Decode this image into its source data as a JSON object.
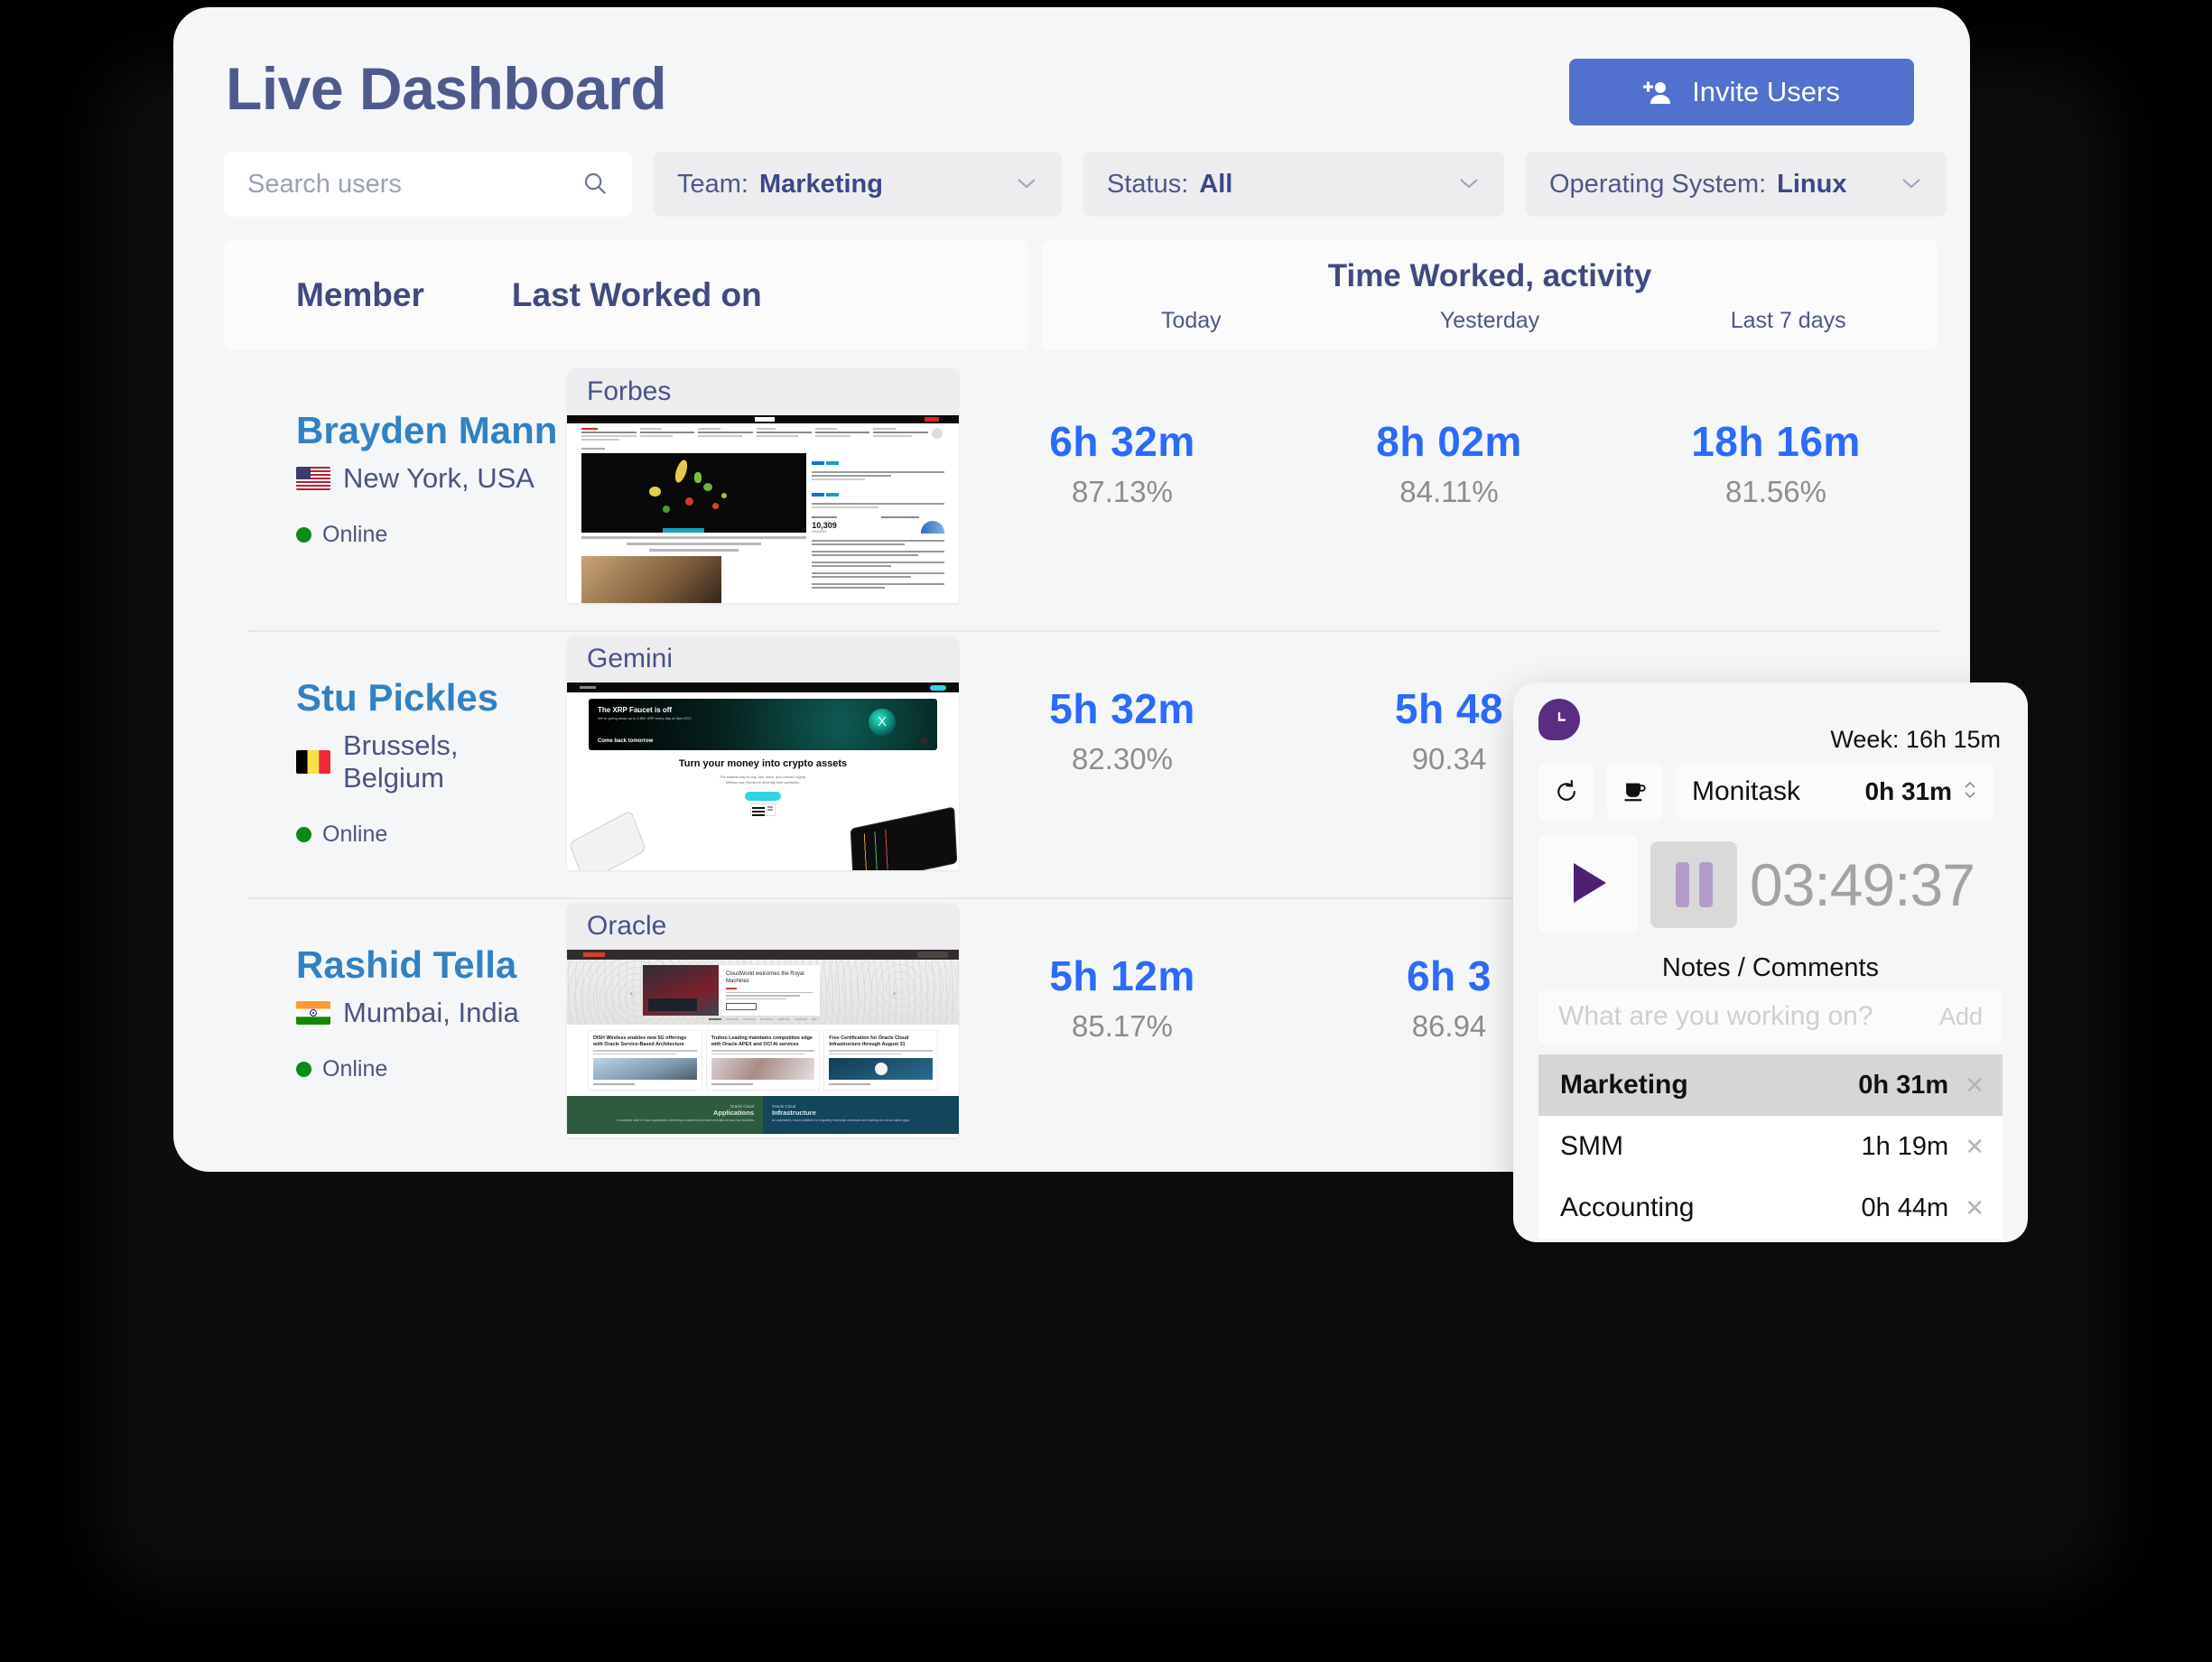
{
  "header": {
    "title": "Live Dashboard",
    "invite_label": "Invite Users",
    "invite_icon": "add-user-icon",
    "accent_color": "#5271ce",
    "title_color": "#4e5a8c"
  },
  "filters": {
    "search_placeholder": "Search users",
    "search_value": "",
    "search_icon": "search-icon",
    "team": {
      "label": "Team:",
      "value": "Marketing"
    },
    "status": {
      "label": "Status:",
      "value": "All"
    },
    "os": {
      "label": "Operating System:",
      "value": "Linux"
    },
    "chevron": "⌄"
  },
  "table": {
    "col_member": "Member",
    "col_last_worked": "Last Worked on",
    "group_title": "Time Worked, activity",
    "subcols": [
      "Today",
      "Yesterday",
      "Last 7 days"
    ]
  },
  "members": [
    {
      "name": "Brayden Mann",
      "location": "New York, USA",
      "flag": "flag-usa",
      "status": "Online",
      "status_color": "#0a8b19",
      "site": "Forbes",
      "today_time": "6h 32m",
      "today_pct": "87.13%",
      "yesterday_time": "8h 02m",
      "yesterday_pct": "84.11%",
      "week_time": "18h 16m",
      "week_pct": "81.56%"
    },
    {
      "name": "Stu Pickles",
      "location": "Brussels, Belgium",
      "flag": "flag-belgium",
      "status": "Online",
      "status_color": "#0a8b19",
      "site": "Gemini",
      "today_time": "5h 32m",
      "today_pct": "82.30%",
      "yesterday_time": "5h 48",
      "yesterday_pct": "90.34",
      "week_time": "",
      "week_pct": ""
    },
    {
      "name": "Rashid Tella",
      "location": "Mumbai, India",
      "flag": "flag-india",
      "status": "Online",
      "status_color": "#0a8b19",
      "site": "Oracle",
      "today_time": "5h 12m",
      "today_pct": "85.17%",
      "yesterday_time": "6h 3",
      "yesterday_pct": "86.94",
      "week_time": "",
      "week_pct": ""
    }
  ],
  "thumbnails": {
    "forbes": {
      "hero_caption": "This AI Startup Has Saved Grocers From Tossing Millions Of Pounds Of Food",
      "popular_label": "Popular",
      "editors_label": "Editors' Picks",
      "count": "10,309",
      "count_sub": "READERS"
    },
    "gemini": {
      "banner_title": "The XRP Faucet is off",
      "banner_sub": "We're giving away up to 4,800 XRP every day at 3pm EDT.",
      "banner_cta": "Come back tomorrow",
      "headline": "Turn your money into crypto assets",
      "cta": "Get started"
    },
    "oracle": {
      "slide_title": "CloudWorld welcomes the Royal Machines",
      "card1": "DISH Wireless enables new 5G offerings with Oracle Service-Based Architecture",
      "card2": "Trulioo Leading maintains competitive edge with Oracle APEX and OCI AI services",
      "card3": "Free Certification for Oracle Cloud Infrastructure through August 31",
      "foot1_small": "Oracle Cloud",
      "foot1_big": "Applications",
      "foot2_small": "Oracle Cloud",
      "foot2_big": "Infrastructure"
    }
  },
  "timer": {
    "clock_icon": "clock-icon",
    "week_label": "Week: 16h 15m",
    "refresh_icon": "refresh-icon",
    "break_icon": "coffee-cup-icon",
    "project_name": "Monitask",
    "project_time": "0h 31m",
    "stepper_icon": "stepper-updown-icon",
    "play_icon": "play-icon",
    "pause_icon": "pause-icon",
    "elapsed": "03:49:37",
    "notes_title": "Notes / Comments",
    "note_placeholder": "What are you working on?",
    "note_value": "",
    "add_label": "Add",
    "accent_color": "#5b2d82",
    "tasks": [
      {
        "name": "Marketing",
        "time": "0h 31m",
        "active": true
      },
      {
        "name": "SMM",
        "time": "1h 19m",
        "active": false
      },
      {
        "name": "Accounting",
        "time": "0h 44m",
        "active": false
      }
    ],
    "remove_icon": "close-icon"
  }
}
